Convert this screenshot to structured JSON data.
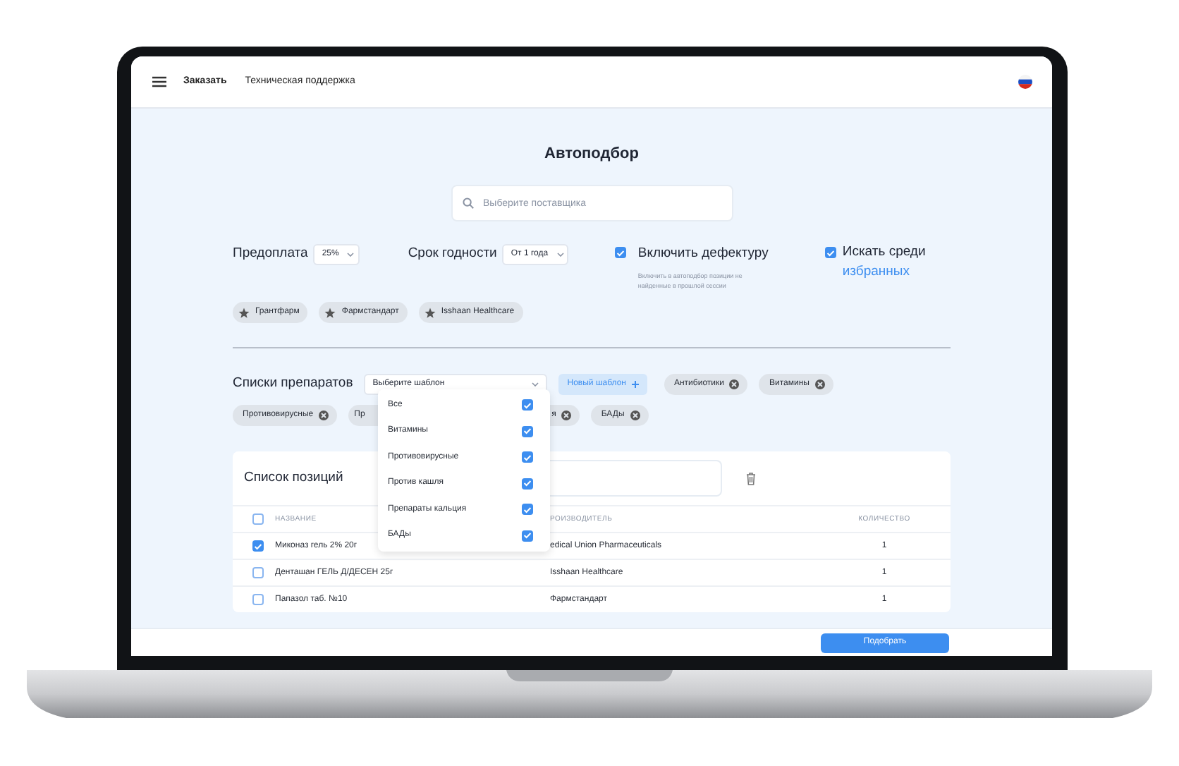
{
  "nav": {
    "links": [
      {
        "label": "Заказать",
        "selected": true
      },
      {
        "label": "Техническая поддержка",
        "selected": false
      }
    ]
  },
  "title": "Автоподбор",
  "supplier_search": {
    "placeholder": "Выберите поставщика"
  },
  "prepayment": {
    "label": "Предоплата",
    "value": "25%"
  },
  "expiry": {
    "label": "Срок годности",
    "value": "От 1 года"
  },
  "defect": {
    "label": "Включить дефектуру",
    "checked": true,
    "hint": "Включить в автоподбор позиции не найденные в прошлой сессии"
  },
  "favorites": {
    "label": "Искать среди",
    "link": "избранных",
    "checked": true
  },
  "suppliers": [
    "Грантфарм",
    "Фармстандарт",
    "Isshaan Healthcare"
  ],
  "lists": {
    "label": "Списки препаратов",
    "template_placeholder": "Выберите шаблон",
    "new_template": "Новый шаблон",
    "chips": [
      {
        "label": "Антибиотики",
        "kind": "full"
      },
      {
        "label": "Витамины",
        "kind": "full"
      },
      {
        "label": "Противовирусные",
        "kind": "full"
      },
      {
        "label": "Пр",
        "kind": "cut_right"
      },
      {
        "label": "я",
        "kind": "cut_left"
      },
      {
        "label": "БАДы",
        "kind": "full"
      }
    ],
    "dropdown": [
      {
        "label": "Все",
        "checked": true
      },
      {
        "label": "Витамины",
        "checked": true
      },
      {
        "label": "Противовирусные",
        "checked": true
      },
      {
        "label": "Против кашля",
        "checked": true
      },
      {
        "label": "Препараты кальция",
        "checked": true
      },
      {
        "label": "БАДы",
        "checked": true
      }
    ]
  },
  "positions": {
    "title": "Список позиций",
    "all_checked": false,
    "columns": [
      "НАЗВАНИЕ",
      "РОИЗВОДИТЕЛЬ",
      "КОЛИЧЕСТВО"
    ],
    "rows": [
      {
        "checked": true,
        "name": "Миконаз гель 2% 20г",
        "maker": "edical Union Pharmaceuticals",
        "quantity": "1"
      },
      {
        "checked": false,
        "name": "Денташан ГЕЛЬ Д/ДЕСЕН 25г",
        "maker": "Isshaan Healthcare",
        "quantity": "1"
      },
      {
        "checked": false,
        "name": "Папазол таб. №10",
        "maker": "Фармстандарт",
        "quantity": "1"
      }
    ]
  },
  "submit": "Подобрать"
}
